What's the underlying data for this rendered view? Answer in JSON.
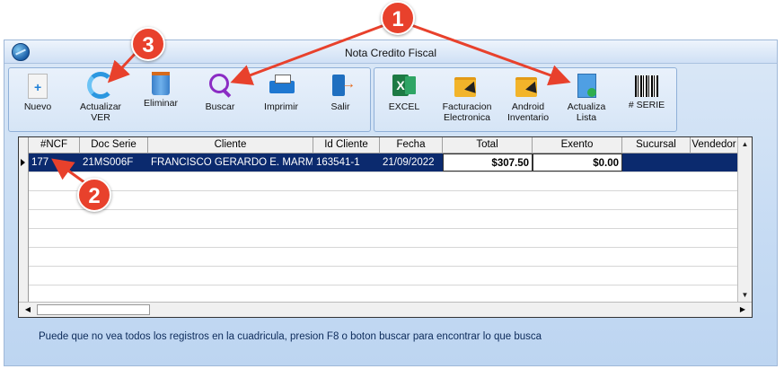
{
  "window": {
    "title": "Nota Credito Fiscal"
  },
  "toolbar": {
    "group1": [
      {
        "label": "Nuevo",
        "icon": "new-document-icon"
      },
      {
        "label": "Actualizar VER",
        "icon": "refresh-icon"
      },
      {
        "label": "Eliminar",
        "icon": "trash-icon"
      },
      {
        "label": "Buscar",
        "icon": "search-icon"
      },
      {
        "label": "Imprimir",
        "icon": "printer-icon"
      },
      {
        "label": "Salir",
        "icon": "exit-icon"
      }
    ],
    "group2": [
      {
        "label": "EXCEL",
        "icon": "excel-icon"
      },
      {
        "label": "Facturacion Electronica",
        "icon": "folder-arrow-icon"
      },
      {
        "label": "Android Inventario",
        "icon": "folder-arrow-icon"
      },
      {
        "label": "Actualiza Lista",
        "icon": "list-refresh-icon"
      },
      {
        "label": "# SERIE",
        "icon": "barcode-icon"
      }
    ]
  },
  "grid": {
    "columns": [
      "#NCF",
      "Doc Serie",
      "Cliente",
      "Id Cliente",
      "Fecha",
      "Total",
      "Exento",
      "Sucursal",
      "Vendedor"
    ],
    "rows": [
      [
        "177",
        "21MS006F",
        "FRANCISCO GERARDO E. MARMOL",
        "163541-1",
        "21/09/2022",
        "$307.50",
        "$0.00",
        "",
        ""
      ]
    ]
  },
  "footer": {
    "message": "Puede que no vea todos los registros en la cuadricula, presion F8 o boton buscar para encontrar lo que busca"
  },
  "annotations": {
    "badge1": "1",
    "badge2": "2",
    "badge3": "3",
    "color": "#e8412c"
  }
}
